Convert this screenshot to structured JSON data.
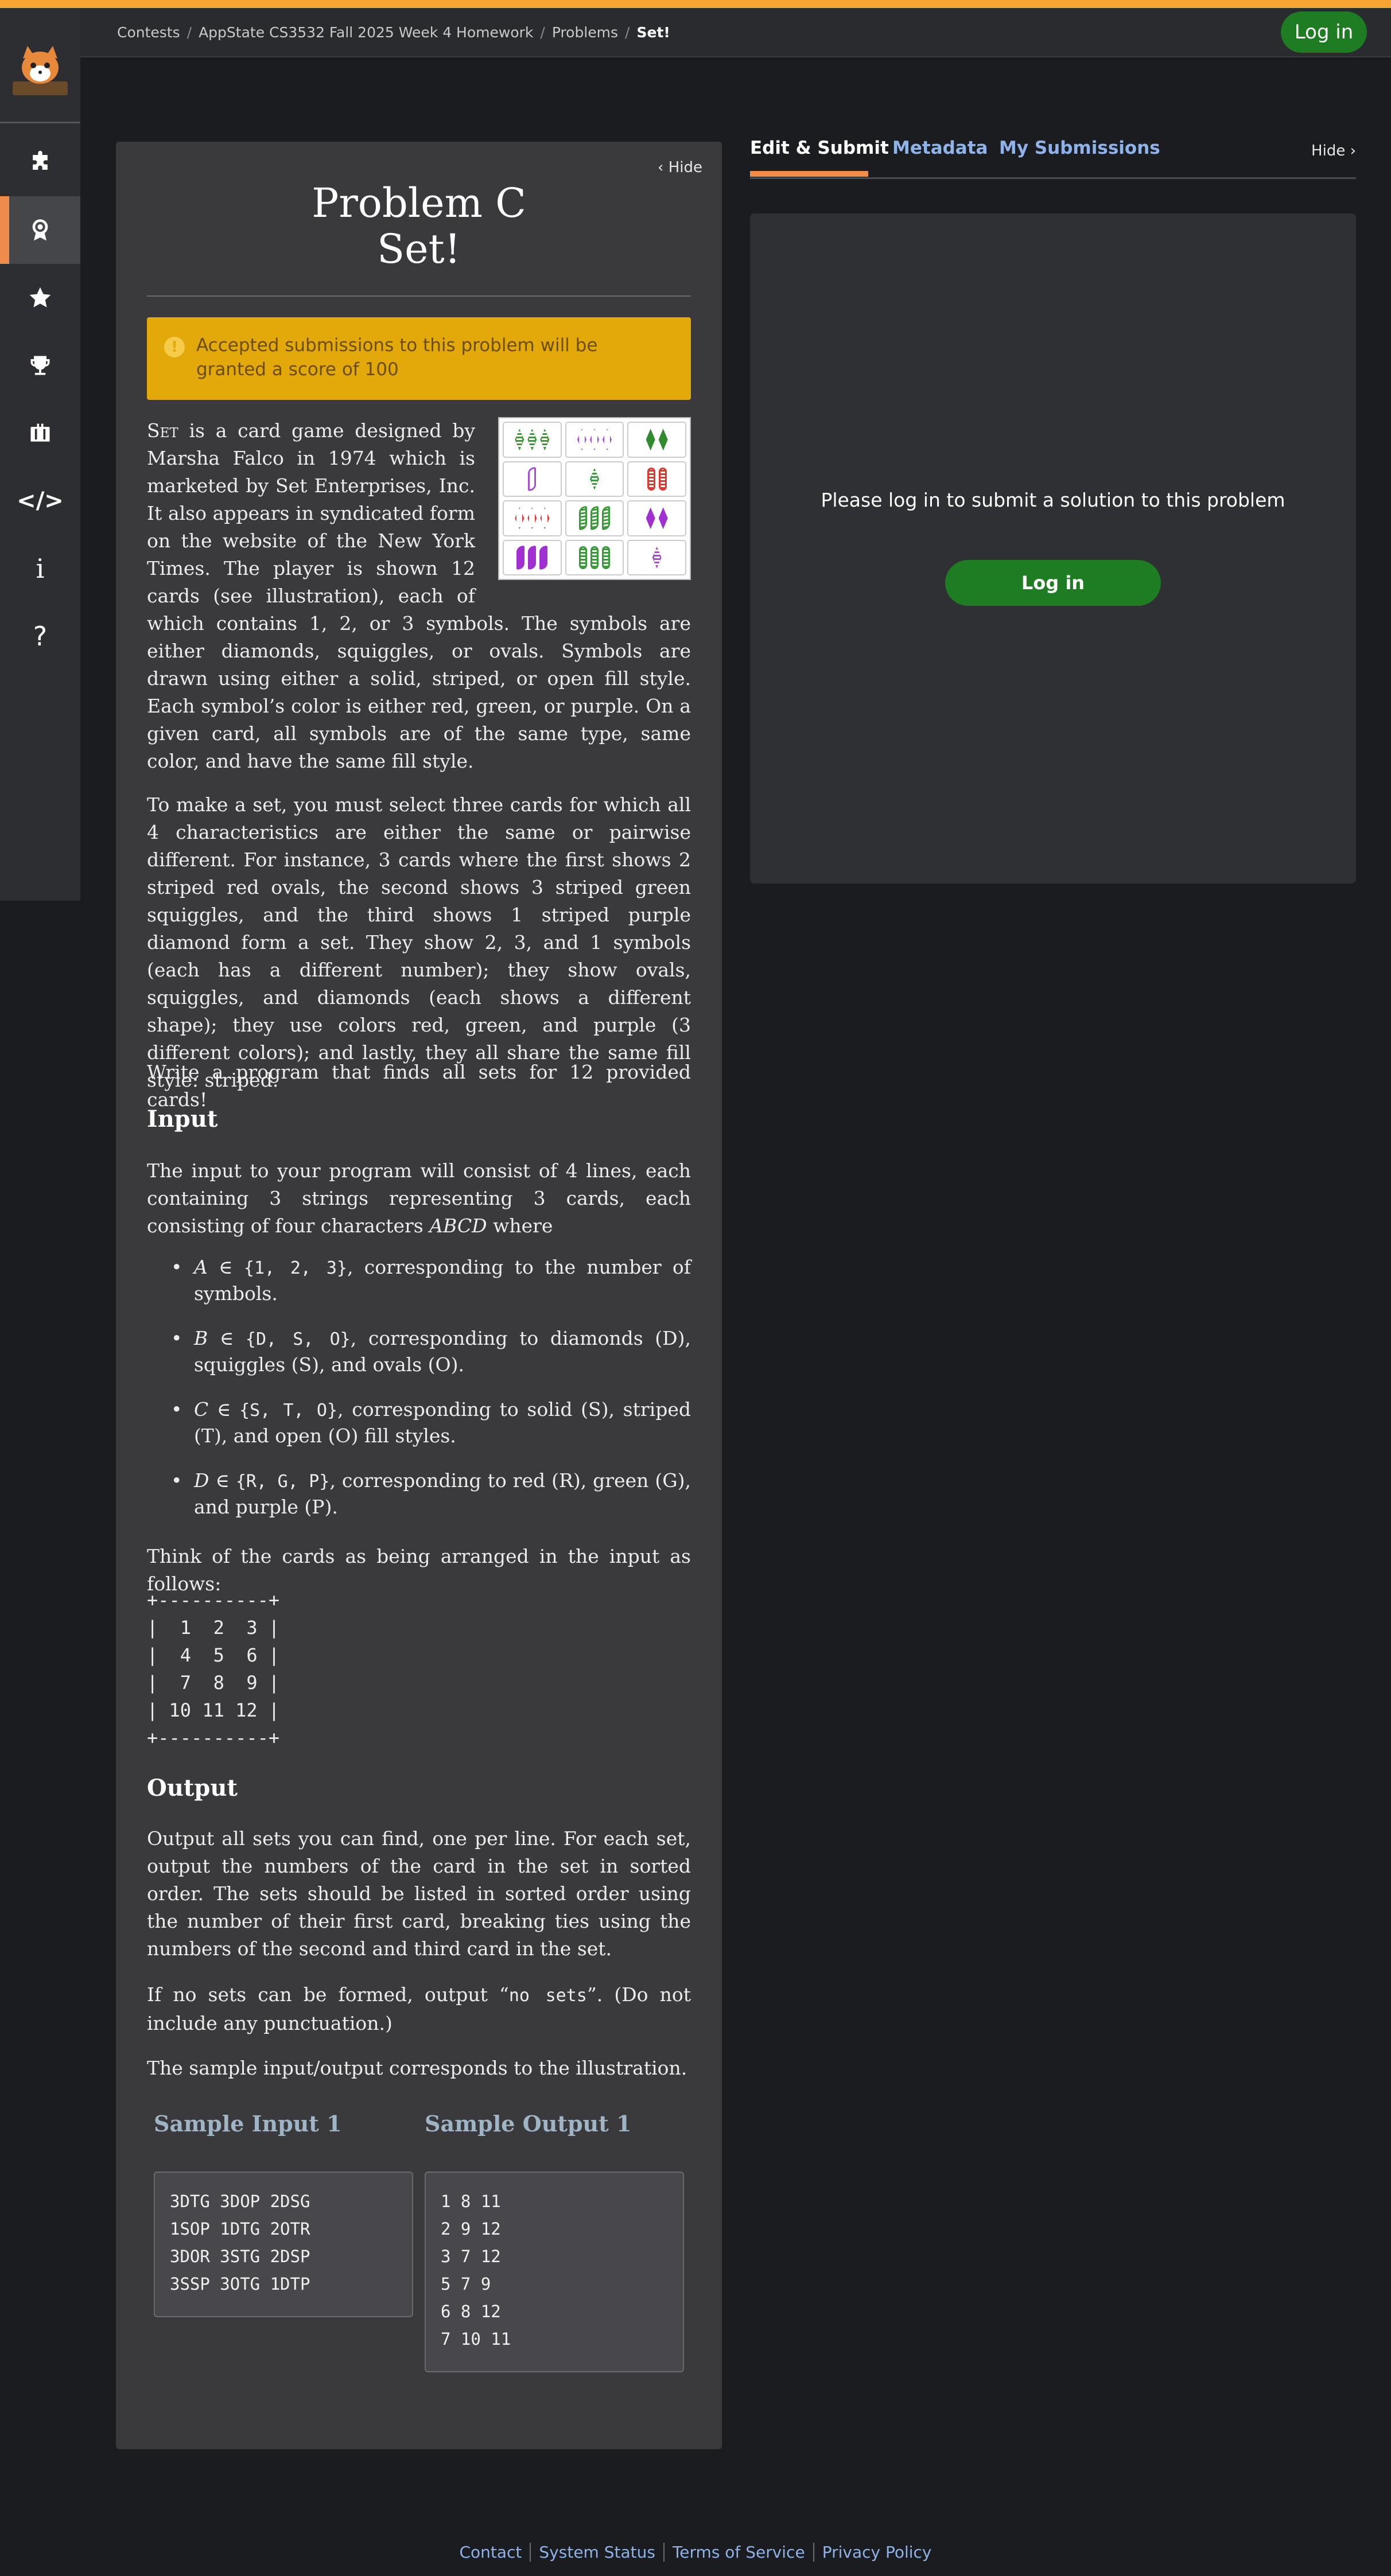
{
  "breadcrumb": {
    "items": [
      "Contests",
      "AppState CS3532 Fall 2025 Week 4 Homework",
      "Problems"
    ],
    "current": "Set!"
  },
  "header": {
    "login_label": "Log in"
  },
  "sidebar": {
    "items": [
      {
        "name": "problems",
        "icon": "puzzle-icon"
      },
      {
        "name": "contests",
        "icon": "award-icon",
        "active": true
      },
      {
        "name": "favorites",
        "icon": "star-icon"
      },
      {
        "name": "rankings",
        "icon": "trophy-icon"
      },
      {
        "name": "jobs",
        "icon": "briefcase-icon"
      },
      {
        "name": "languages",
        "icon": "code-icon",
        "glyph": "</>"
      },
      {
        "name": "info",
        "icon": "info-icon",
        "glyph": "i"
      },
      {
        "name": "help",
        "icon": "help-icon",
        "glyph": "?"
      }
    ]
  },
  "problem": {
    "hide_label": "Hide",
    "title_line1": "Problem C",
    "title_line2": "Set!",
    "alert": "Accepted submissions to this problem will be granted a score of 100",
    "set_word": "Set",
    "para1_rest": " is a card game designed by Marsha Falco in 1974 which is marketed by Set Enterprises, Inc. It also appears in syndicated form on the website of the New York Times. The player is shown 12 cards (see illustration), each of which contains 1, 2, or 3 symbols. The symbols are either diamonds, squiggles, or ovals. Symbols are drawn using either a solid, striped, or open fill style. Each symbol’s color is either red, green, or purple. On a given card, all symbols are of the same type, same color, and have the same fill style.",
    "para2": "To make a set, you must select three cards for which all 4 characteristics are either the same or pairwise different. For instance, 3 cards where the first shows 2 striped red ovals, the second shows 3 striped green squiggles, and the third shows 1 striped purple diamond form a set. They show 2, 3, and 1 symbols (each has a different number); they show ovals, squiggles, and diamonds (each shows a different shape); they use colors red, green, and purple (3 different colors); and lastly, they all share the same fill style: striped.",
    "para3": "Write a program that finds all sets for 12 provided cards!",
    "input_heading": "Input",
    "input_intro_a": "The input to your program will consist of 4 lines, each containing 3 strings representing 3 cards, each consisting of four characters ",
    "input_intro_math": "ABCD",
    "input_intro_b": " where",
    "bullets": [
      {
        "var": "A",
        "set": "{1, 2, 3}",
        "text": ", corresponding to the number of symbols."
      },
      {
        "var": "B",
        "set": "{D, S, O}",
        "text": ", corresponding to diamonds (D), squiggles (S), and ovals (O)."
      },
      {
        "var": "C",
        "set": "{S, T, O}",
        "text": ", corresponding to solid (S), striped (T), and open (O) fill styles."
      },
      {
        "var": "D",
        "set": "{R, G, P}",
        "text": ", corresponding to red (R), green (G), and purple (P)."
      }
    ],
    "arrangement_intro": "Think of the cards as being arranged in the input as follows:",
    "arrangement": "+----------+\n|  1  2  3 |\n|  4  5  6 |\n|  7  8  9 |\n| 10 11 12 |\n+----------+",
    "output_heading": "Output",
    "output_para1": "Output all sets you can find, one per line. For each set, output the numbers of the card in the set in sorted order. The sets should be listed in sorted order using the number of their first card, breaking ties using the numbers of the second and third card in the set.",
    "output_para2_a": "If no sets can be formed, output “",
    "output_para2_code": "no sets",
    "output_para2_b": "”. (Do not include any punctuation.)",
    "output_para3": "The sample input/output corresponds to the illustration.",
    "sample_input_heading": "Sample Input 1",
    "sample_output_heading": "Sample Output 1",
    "sample_input": "3DTG 3DOP 2DSG\n1SOP 1DTG 2OTR\n3DOR 3STG 2DSP\n3SSP 3OTG 1DTP",
    "sample_output": "1 8 11\n2 9 12\n3 7 12\n5 7 9\n6 8 12\n7 10 11"
  },
  "illustration": {
    "cards": [
      {
        "count": 3,
        "shape": "dia",
        "fill": "striped",
        "color": "#3a9a3a"
      },
      {
        "count": 3,
        "shape": "dia",
        "fill": "open",
        "color": "#a64ad8"
      },
      {
        "count": 2,
        "shape": "dia",
        "fill": "solid",
        "color": "#2e8b2e"
      },
      {
        "count": 1,
        "shape": "squ",
        "fill": "open",
        "color": "#a64ad8"
      },
      {
        "count": 1,
        "shape": "dia",
        "fill": "striped",
        "color": "#3a9a3a"
      },
      {
        "count": 2,
        "shape": "oval",
        "fill": "striped",
        "color": "#e43434"
      },
      {
        "count": 3,
        "shape": "dia",
        "fill": "open",
        "color": "#e43434"
      },
      {
        "count": 3,
        "shape": "squ",
        "fill": "striped",
        "color": "#3a9a3a"
      },
      {
        "count": 2,
        "shape": "dia",
        "fill": "solid",
        "color": "#a030d0"
      },
      {
        "count": 3,
        "shape": "squ",
        "fill": "solid",
        "color": "#a030d0"
      },
      {
        "count": 3,
        "shape": "oval",
        "fill": "striped",
        "color": "#3a9a3a"
      },
      {
        "count": 1,
        "shape": "dia",
        "fill": "striped",
        "color": "#a64ad8"
      }
    ]
  },
  "right_panel": {
    "tabs": [
      "Edit & Submit",
      "Metadata",
      "My Submissions"
    ],
    "active_tab": "Edit & Submit",
    "hide_label": "Hide",
    "message": "Please log in to submit a solution to this problem",
    "login_label": "Log in"
  },
  "footer": {
    "links": [
      "Contact",
      "System Status",
      "Terms of Service",
      "Privacy Policy"
    ]
  },
  "colors": {
    "accent": "#f6a531",
    "tab_underline": "#f08c4a",
    "login_green": "#1e7d22",
    "alert": "#e3a90b",
    "link": "#8fb3e8"
  }
}
